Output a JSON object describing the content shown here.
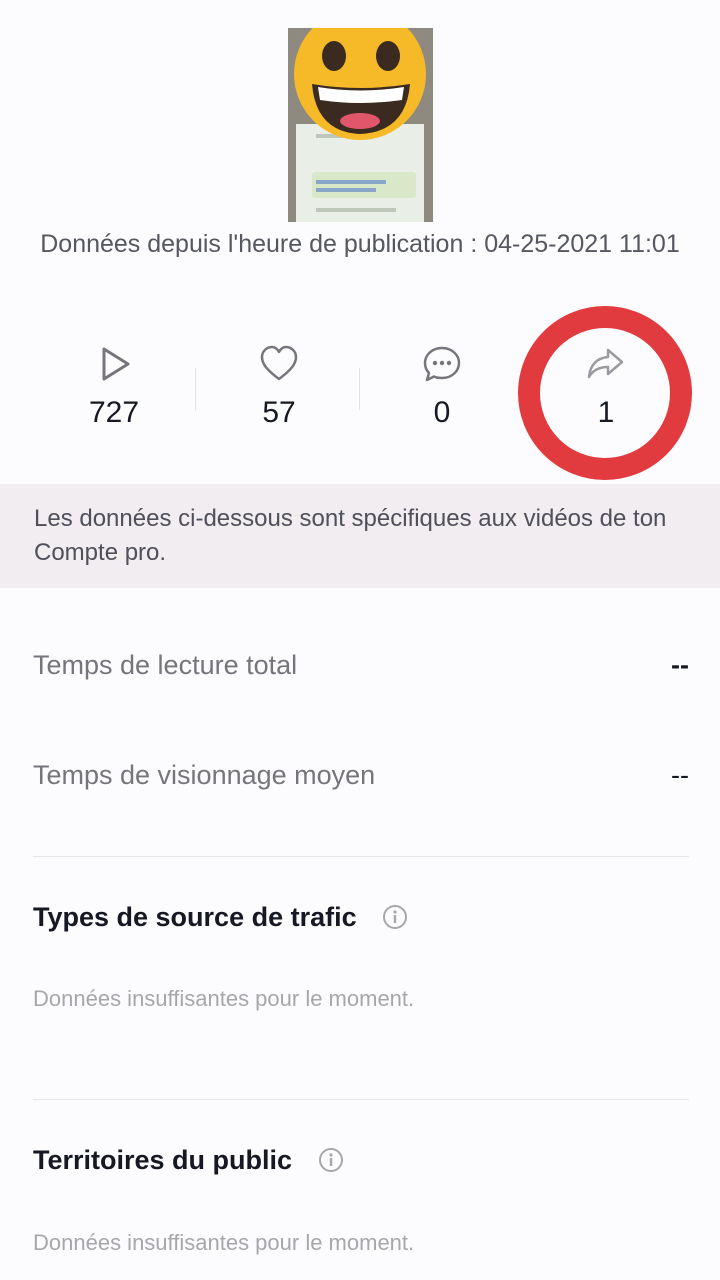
{
  "publication": {
    "label": "Données depuis l'heure de publication : 04-25-2021 11:01"
  },
  "stats": {
    "views": "727",
    "likes": "57",
    "comments": "0",
    "shares": "1",
    "highlight_color": "#e23b3f"
  },
  "notice": {
    "text": "Les données ci-dessous sont spécifiques aux vidéos de ton Compte pro."
  },
  "metrics": [
    {
      "label": "Temps de lecture total",
      "value": "--"
    },
    {
      "label": "Temps de visionnage moyen",
      "value": "--"
    }
  ],
  "sections": [
    {
      "title": "Types de source de trafic",
      "empty": "Données insuffisantes pour le moment."
    },
    {
      "title": "Territoires du public",
      "empty": "Données insuffisantes pour le moment."
    }
  ],
  "icons": {
    "views": "play-icon",
    "likes": "heart-icon",
    "comments": "comment-icon",
    "shares": "share-icon",
    "info": "info-icon"
  }
}
